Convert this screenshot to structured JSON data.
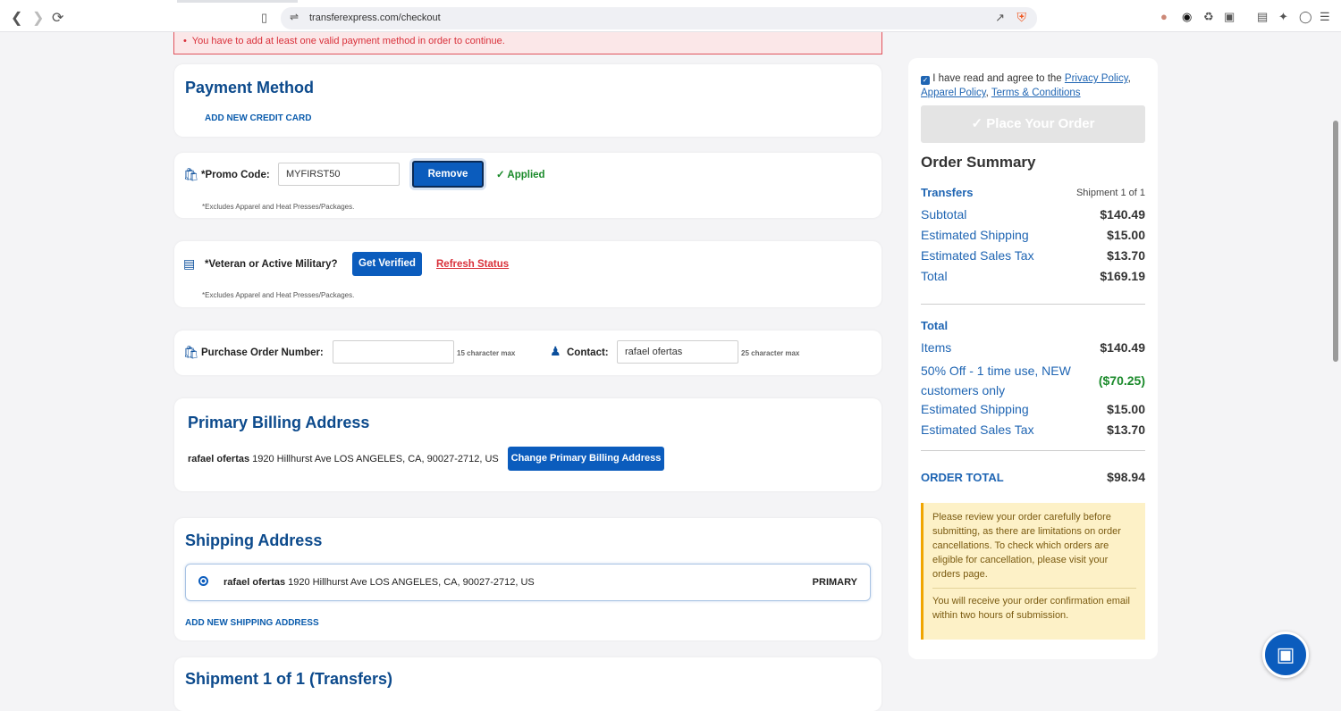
{
  "browser": {
    "url": "transferexpress.com/checkout"
  },
  "error": "You have to add at least one valid payment method in order to continue.",
  "payment": {
    "title": "Payment Method",
    "add_card": "ADD NEW CREDIT CARD"
  },
  "promo": {
    "label": "*Promo Code:",
    "value": "MYFIRST50",
    "remove": "Remove",
    "status": "Applied",
    "note": "*Excludes Apparel and Heat Presses/Packages."
  },
  "military": {
    "label": "*Veteran or Active Military?",
    "verify": "Get Verified",
    "refresh": "Refresh Status",
    "note": "*Excludes Apparel and Heat Presses/Packages."
  },
  "po": {
    "label": "Purchase Order Number:",
    "value": "",
    "hint": "15 character max",
    "contact_label": "Contact:",
    "contact_value": "rafael ofertas",
    "contact_hint": "25 character max"
  },
  "billing": {
    "title": "Primary Billing Address",
    "name": "rafael ofertas",
    "address": "1920 Hillhurst Ave LOS ANGELES, CA, 90027-2712, US",
    "change": "Change Primary Billing Address"
  },
  "shipping": {
    "title": "Shipping Address",
    "name": "rafael ofertas",
    "address": "1920 Hillhurst Ave LOS ANGELES, CA, 90027-2712, US",
    "badge": "PRIMARY",
    "add": "ADD NEW SHIPPING ADDRESS"
  },
  "shipment": {
    "title": "Shipment 1 of 1 (Transfers)"
  },
  "summary": {
    "agree_text": "I have read and agree to the",
    "privacy": "Privacy Policy",
    "apparel": "Apparel Policy",
    "terms": "Terms & Conditions",
    "place_order": "Place Your Order",
    "title": "Order Summary",
    "transfers": "Transfers",
    "shipment": "Shipment 1 of 1",
    "rows1": [
      {
        "k": "Subtotal",
        "v": "$140.49"
      },
      {
        "k": "Estimated Shipping",
        "v": "$15.00"
      },
      {
        "k": "Estimated Sales Tax",
        "v": "$13.70"
      },
      {
        "k": "Total",
        "v": "$169.19"
      }
    ],
    "total_head": "Total",
    "items": {
      "k": "Items",
      "v": "$140.49"
    },
    "discount": {
      "k": "50% Off - 1 time use, NEW customers only",
      "v": "($70.25)"
    },
    "ship": {
      "k": "Estimated Shipping",
      "v": "$15.00"
    },
    "tax": {
      "k": "Estimated Sales Tax",
      "v": "$13.70"
    },
    "order_total": {
      "k": "ORDER TOTAL",
      "v": "$98.94"
    },
    "notice1": "Please review your order carefully before submitting, as there are limitations on order cancellations. To check which orders are eligible for cancellation, please visit your orders page.",
    "notice2": "You will receive your order confirmation email within two hours of submission.",
    "accent": "#1f65b3",
    "discount_color": "#1a8a2a"
  }
}
